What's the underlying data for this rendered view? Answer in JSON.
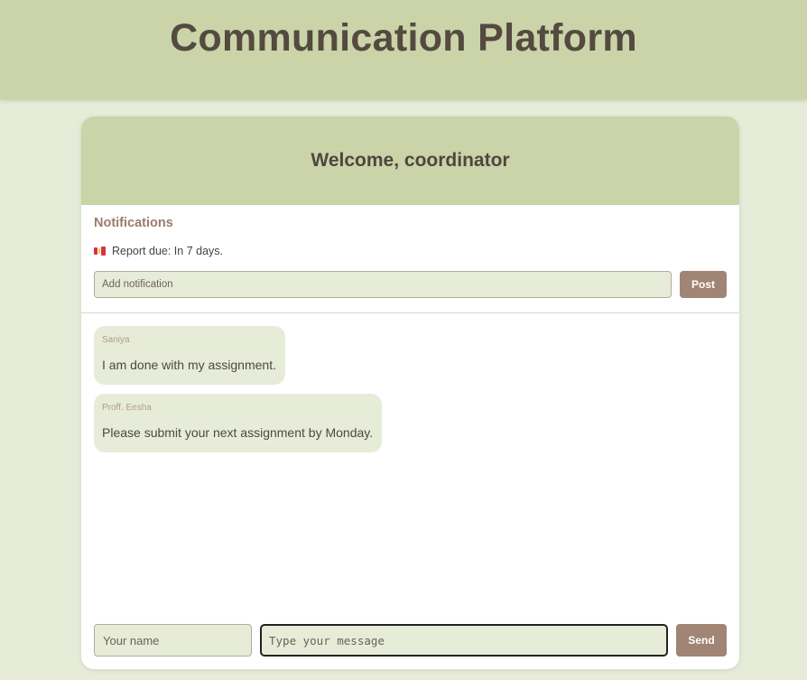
{
  "header": {
    "title": "Communication Platform"
  },
  "welcome": {
    "text": "Welcome, coordinator"
  },
  "notifications": {
    "title": "Notifications",
    "items": [
      {
        "icon": "canada-flag-icon",
        "text": "Report due: In 7 days."
      }
    ],
    "input_placeholder": "Add notification",
    "post_label": "Post"
  },
  "messages": [
    {
      "sender": "Saniya",
      "text": "I am done with my assignment."
    },
    {
      "sender": "Proff. Eesha",
      "text": "Please submit your next assignment by Monday."
    }
  ],
  "composer": {
    "name_placeholder": "Your name",
    "message_placeholder": "Type your message",
    "send_label": "Send"
  },
  "colors": {
    "background": "#e6ecd8",
    "header": "#cbd3a9",
    "button": "#a08474",
    "accent_text": "#9a7c6c"
  }
}
